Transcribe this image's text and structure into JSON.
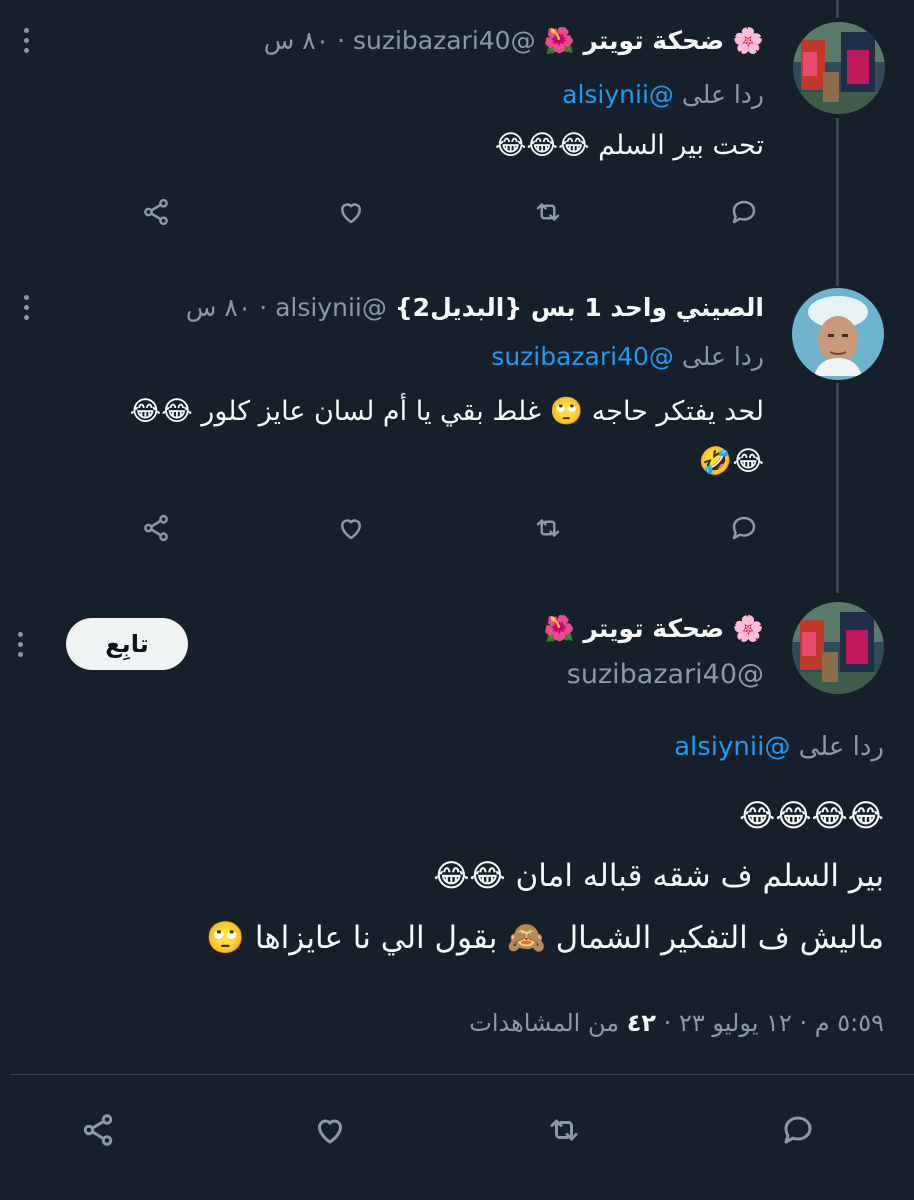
{
  "colors": {
    "background": "#15202b",
    "text": "#f7f9f9",
    "muted": "#8b98a5",
    "link": "#1d9bf0",
    "divider": "#38444d",
    "follow_bg": "#eff3f4"
  },
  "tweets": [
    {
      "display_name": "🌸 ضحكة تويتر 🌺",
      "handle": "@suzibazari40",
      "time": "٨٠ س",
      "reply_prefix": "ردا على",
      "reply_to": "@alsiynii",
      "text_lines": [
        "تحت بير السلم 😂😂😂"
      ],
      "avatar_icon": "avatar-painting-icon"
    },
    {
      "display_name": "الصيني واحد 1 بس {البديل2}",
      "handle": "@alsiynii",
      "time": "٨٠ س",
      "reply_prefix": "ردا على",
      "reply_to": "@suzibazari40",
      "text_lines": [
        "لحد يفتكر حاجه 🙄 غلط بقي يا أم لسان عايز كلور 😂😂",
        "😂🤣"
      ],
      "avatar_icon": "avatar-man-icon"
    }
  ],
  "main_tweet": {
    "display_name": "🌸 ضحكة تويتر 🌺",
    "handle": "@suzibazari40",
    "follow_label": "تابِع",
    "reply_prefix": "ردا على",
    "reply_to": "@alsiynii",
    "text_lines": [
      "😂😂😂😂",
      "بير السلم ف شقه قباله امان 😂😂",
      "ماليش ف التفكير الشمال 🙈 بقول الي نا عايزاها 🙄"
    ],
    "meta": {
      "time": "٥:٥٩ م",
      "date": "١٢ يوليو ٢٣",
      "views_count": "٤٢",
      "views_label": "من المشاهدات",
      "separator": "·"
    }
  },
  "action_icons": [
    "reply-icon",
    "retweet-icon",
    "like-icon",
    "share-icon"
  ]
}
